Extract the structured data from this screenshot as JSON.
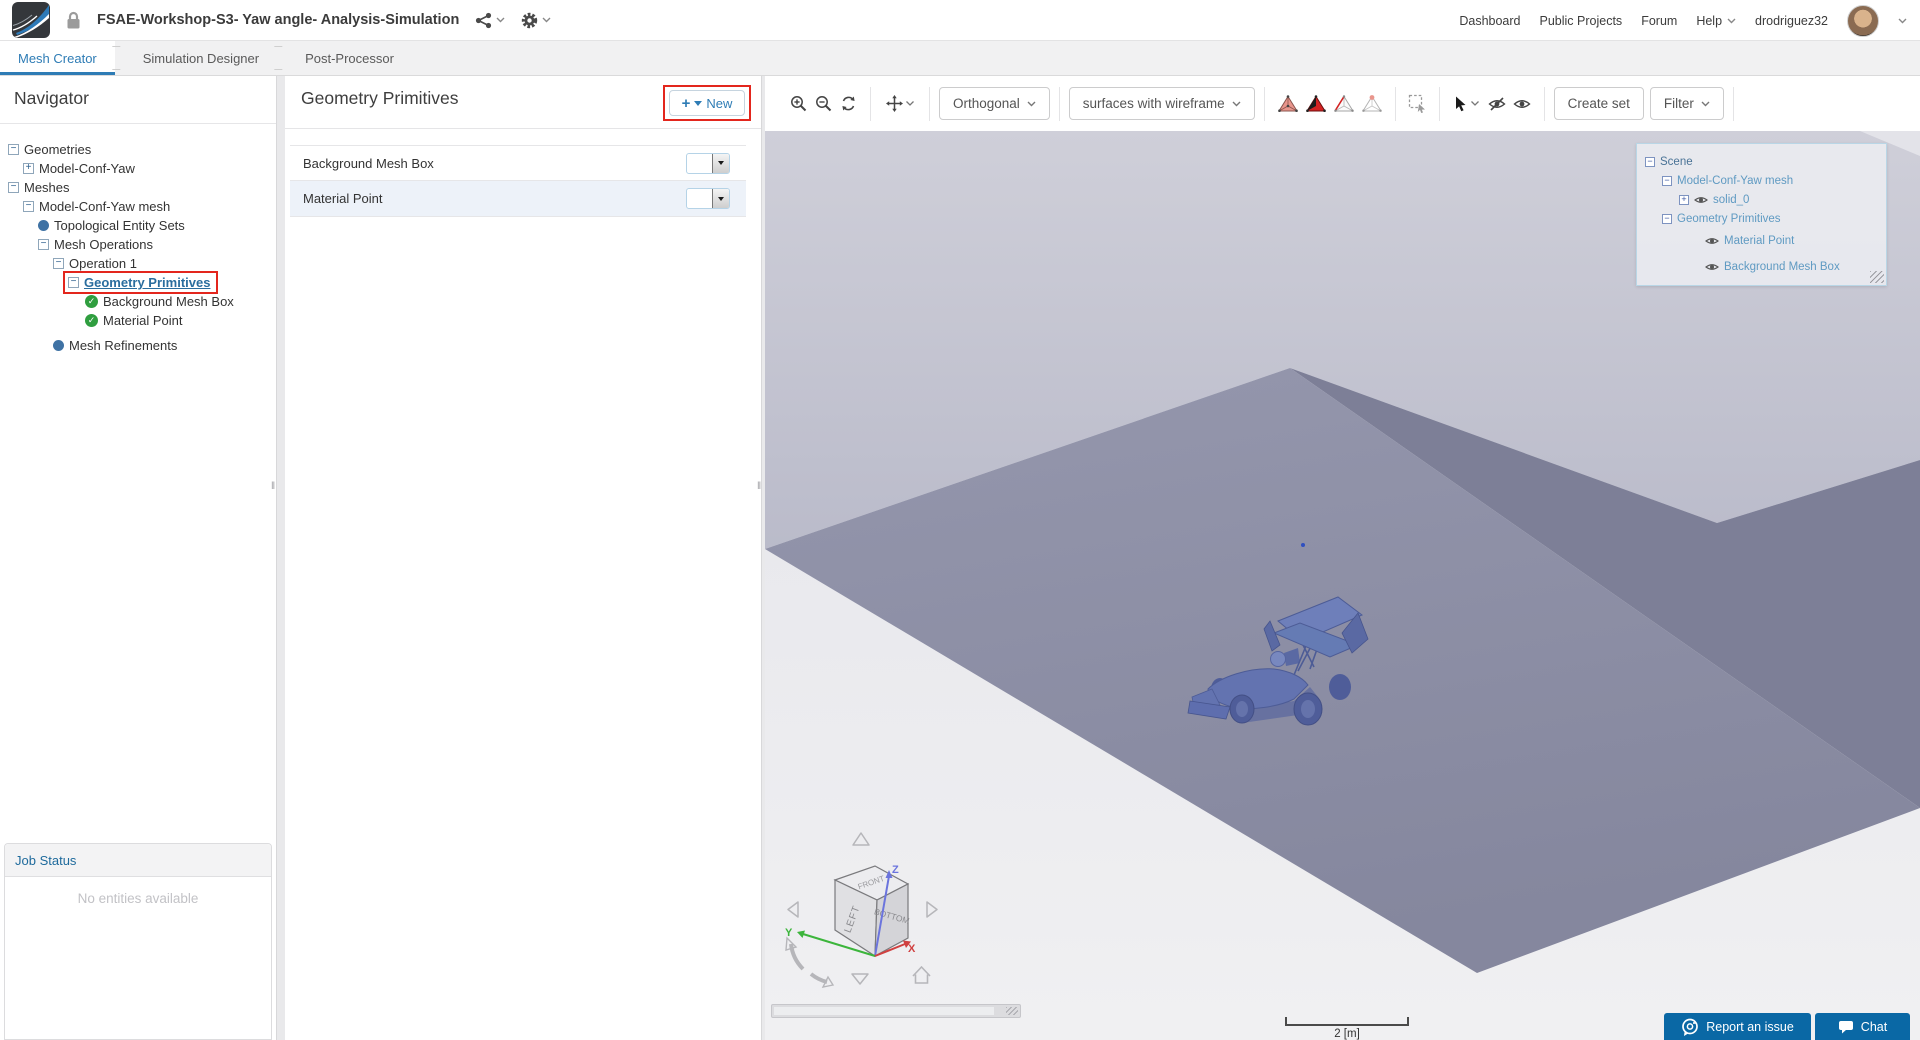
{
  "header": {
    "title": "FSAE-Workshop-S3- Yaw angle- Analysis-Simulation",
    "nav_links": [
      "Dashboard",
      "Public Projects",
      "Forum",
      "Help"
    ],
    "username": "drodriguez32"
  },
  "tabs": {
    "items": [
      "Mesh Creator",
      "Simulation Designer",
      "Post-Processor"
    ],
    "active": "Mesh Creator"
  },
  "navigator": {
    "title": "Navigator",
    "tree": [
      {
        "label": "Geometries"
      },
      {
        "label": "Model-Conf-Yaw"
      },
      {
        "label": "Meshes"
      },
      {
        "label": "Model-Conf-Yaw mesh"
      },
      {
        "label": "Topological Entity Sets"
      },
      {
        "label": "Mesh Operations"
      },
      {
        "label": "Operation 1"
      },
      {
        "label": "Geometry Primitives"
      },
      {
        "label": "Background Mesh Box"
      },
      {
        "label": "Material Point"
      },
      {
        "label": "Mesh Refinements"
      }
    ],
    "job_status": {
      "title": "Job Status",
      "empty_message": "No entities available"
    }
  },
  "primitives_panel": {
    "title": "Geometry Primitives",
    "new_button": "New",
    "rows": [
      {
        "label": "Background Mesh Box"
      },
      {
        "label": "Material Point"
      }
    ]
  },
  "viewport": {
    "toolbar": {
      "projection": "Orthogonal",
      "render_mode": "surfaces with wireframe",
      "create_set": "Create set",
      "filter": "Filter"
    },
    "scene_tree": [
      {
        "label": "Scene"
      },
      {
        "label": "Model-Conf-Yaw mesh"
      },
      {
        "label": "solid_0"
      },
      {
        "label": "Geometry Primitives"
      },
      {
        "label": "Material Point"
      },
      {
        "label": "Background Mesh Box"
      }
    ],
    "orientation_cube": {
      "faces": {
        "top": "FRONT",
        "left": "LEFT",
        "right": "BOTTOM"
      },
      "axes": {
        "x": "X",
        "y": "Y",
        "z": "Z"
      }
    },
    "scale_label": "2 [m]",
    "report_button": "Report an issue",
    "chat_button": "Chat"
  },
  "colors": {
    "accent_blue": "#2e7cb5",
    "link_blue": "#2a6d9e",
    "highlight_red": "#e3261d",
    "ground_plane": "#8d8fa6",
    "ground_plane_dark": "#7d7f97",
    "box_top_face": "#c5c6d2",
    "footer_button_blue": "#0a68a5",
    "model_blue": "#6474b1"
  }
}
